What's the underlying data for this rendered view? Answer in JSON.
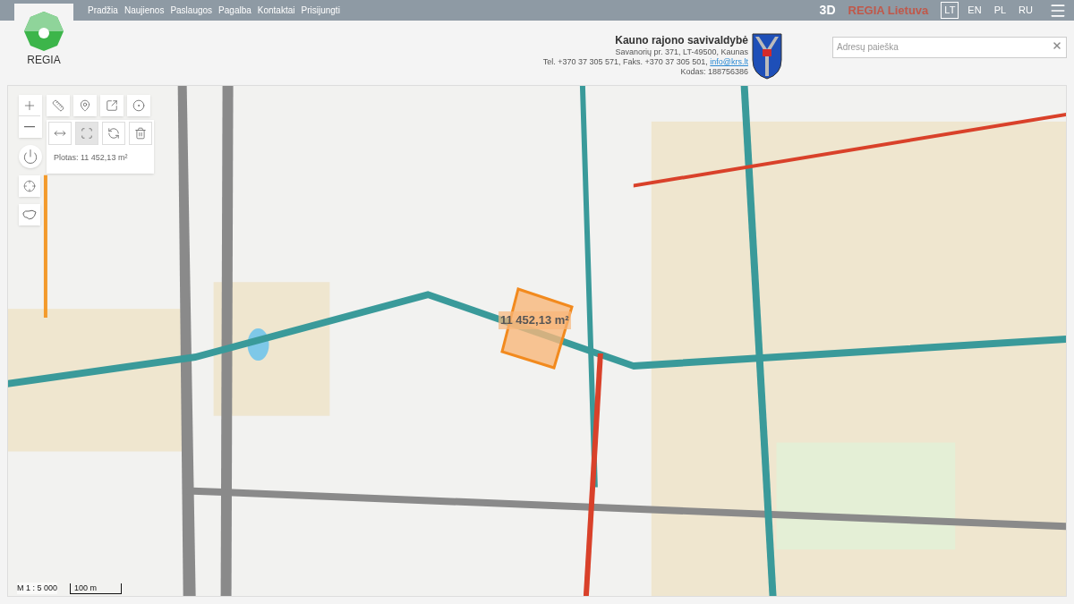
{
  "nav": {
    "items": [
      "Pradžia",
      "Naujienos",
      "Paslaugos",
      "Pagalba",
      "Kontaktai",
      "Prisijungti"
    ]
  },
  "top_right": {
    "view_3d": "3D",
    "brand": "REGIA Lietuva",
    "languages": [
      {
        "label": "LT",
        "selected": true
      },
      {
        "label": "EN",
        "selected": false
      },
      {
        "label": "PL",
        "selected": false
      },
      {
        "label": "RU",
        "selected": false
      }
    ]
  },
  "logo": {
    "text": "REGIA"
  },
  "municipality": {
    "name": "Kauno rajono savivaldybė",
    "address": "Savanorių pr. 371, LT-49500, Kaunas",
    "phone": "Tel. +370 37 305 571, Faks. +370 37 305 501, ",
    "email": "info@krs.lt",
    "code": "Kodas: 188756386"
  },
  "search": {
    "placeholder": "Adresų paieška"
  },
  "map": {
    "tool_rows": [
      [
        {
          "kind": "ruler",
          "selected": false
        },
        {
          "kind": "pin",
          "selected": false
        },
        {
          "kind": "export",
          "selected": false
        },
        {
          "kind": "target",
          "selected": false
        }
      ],
      [
        {
          "kind": "distance",
          "selected": false
        },
        {
          "kind": "area",
          "selected": true
        },
        {
          "kind": "history",
          "selected": false
        },
        {
          "kind": "trash",
          "selected": false
        }
      ]
    ],
    "measure_result": "Plotas: 11 452,13 m²",
    "area_label": "11 452,13 m²",
    "scale": "M 1 : 5 000",
    "scale_bar": "100 m"
  }
}
